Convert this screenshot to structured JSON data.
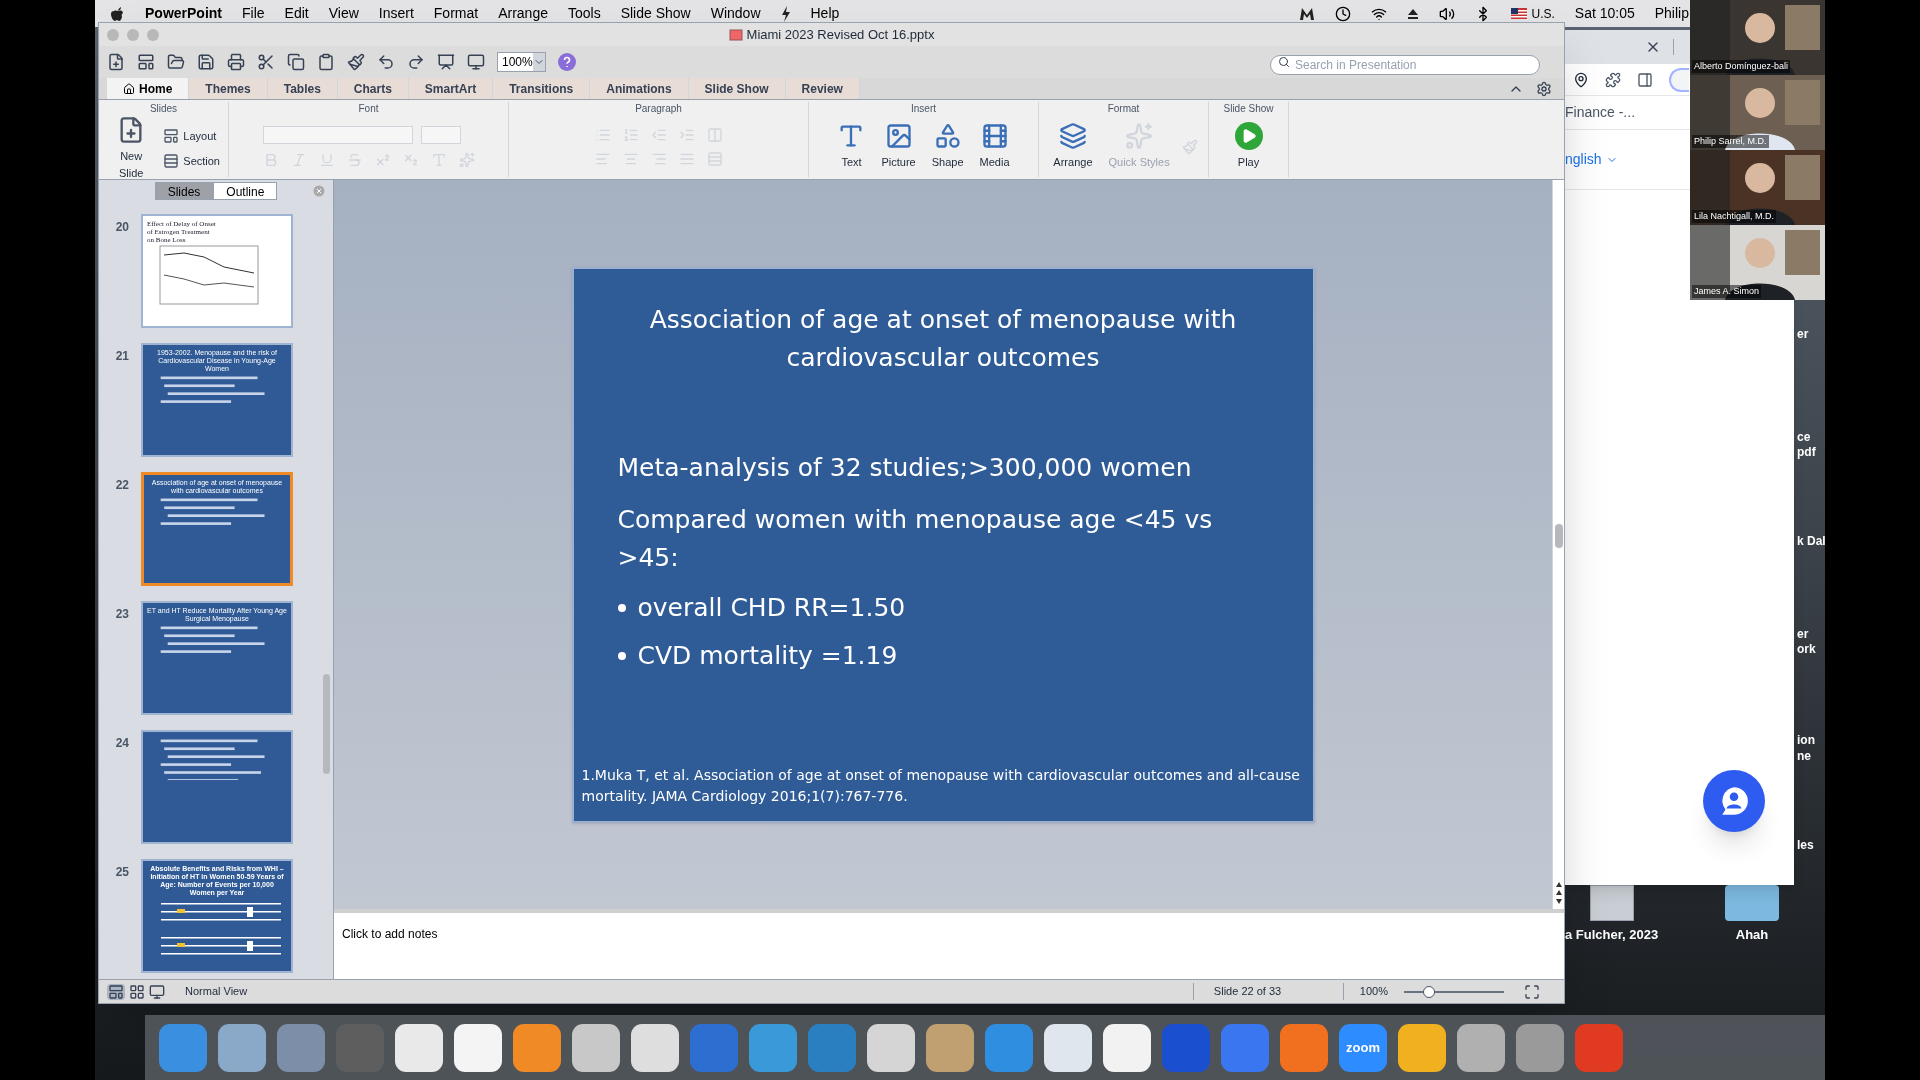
{
  "menu_bar": {
    "app": "PowerPoint",
    "items": [
      "File",
      "Edit",
      "View",
      "Insert",
      "Format",
      "Arrange",
      "Tools",
      "Slide Show",
      "Window",
      "Help"
    ],
    "input_source": "U.S.",
    "clock": "Sat 10:05",
    "user": "Philip"
  },
  "window": {
    "title": "Miami 2023 Revised Oct 16.pptx",
    "zoom": "100%",
    "search": {
      "placeholder": "Search in Presentation"
    }
  },
  "ribbon": {
    "tabs": [
      {
        "label": "Home",
        "selected": true
      },
      {
        "label": "Themes",
        "selected": false
      },
      {
        "label": "Tables",
        "selected": false
      },
      {
        "label": "Charts",
        "selected": false
      },
      {
        "label": "SmartArt",
        "selected": false
      },
      {
        "label": "Transitions",
        "selected": false
      },
      {
        "label": "Animations",
        "selected": false
      },
      {
        "label": "Slide Show",
        "selected": false
      },
      {
        "label": "Review",
        "selected": false
      }
    ],
    "groups": [
      "Slides",
      "Font",
      "Paragraph",
      "Insert",
      "Format",
      "Slide Show"
    ],
    "new_slide": "New Slide",
    "layout": "Layout",
    "section": "Section",
    "insert_buttons": [
      "Text",
      "Picture",
      "Shape",
      "Media"
    ],
    "format_buttons": [
      {
        "label": "Arrange",
        "disabled": false
      },
      {
        "label": "Quick Styles",
        "disabled": true
      }
    ],
    "play": "Play"
  },
  "pane": {
    "tabs": [
      {
        "label": "Slides",
        "selected": true
      },
      {
        "label": "Outline",
        "selected": false
      }
    ],
    "thumbnails": [
      {
        "number": "20",
        "kind": "chart",
        "title": "Effect of Delay of Onset of Estrogen Treatment on Bone Loss",
        "selected": false
      },
      {
        "number": "21",
        "kind": "text",
        "title": "1953-2002. Menopause and the risk of Cardiovascular Disease in Young-Age Women",
        "selected": false
      },
      {
        "number": "22",
        "kind": "text",
        "title": "Association of age at onset of menopause with cardiovascular outcomes",
        "selected": true
      },
      {
        "number": "23",
        "kind": "text",
        "title": "ET and HT Reduce Mortality After Young Age Surgical Menopause",
        "selected": false
      },
      {
        "number": "24",
        "kind": "text",
        "selected": false
      },
      {
        "number": "25",
        "kind": "table",
        "title": "Absolute Benefits and Risks from WHI – Initiation of HT in Women 50-59 Years of Age: Number of Events per 10,000 Women per Year",
        "selected": false
      }
    ]
  },
  "slide": {
    "title": "Association of age at onset of menopause with\ncardiovascular outcomes",
    "lines": [
      {
        "text": "Meta-analysis of 32 studies;>300,000 women",
        "bullet": false
      },
      {
        "text": "Compared women with menopause age <45 vs\n>45:",
        "bullet": false
      },
      {
        "text": "overall CHD RR=1.50",
        "bullet": true
      },
      {
        "text": "CVD mortality  =1.19",
        "bullet": true
      }
    ],
    "reference": "1.Muka T, et al. Association of age at onset of menopause with cardiovascular outcomes and all-cause mortality.  JAMA Cardiology 2016;1(7):767-776."
  },
  "notes": {
    "placeholder": "Click to add notes"
  },
  "status_bar": {
    "view": "Normal View",
    "slide": "Slide 22 of 33",
    "zoom": "100%",
    "level": 0.25
  },
  "browser": {
    "tab": "Finance -...",
    "language": "nglish"
  },
  "desktop": {
    "edge_labels": [
      "er",
      "ce",
      "pdf",
      "k Dal",
      "er",
      "ork",
      "ion",
      "ne",
      "les"
    ],
    "icons": [
      {
        "label": "a Fulcher, 2023",
        "kind": "document"
      },
      {
        "label": "Ahah",
        "kind": "folder"
      }
    ]
  },
  "video_tiles": [
    {
      "name": "Alberto Domínguez-bali"
    },
    {
      "name": "Philip Sarrel, M.D."
    },
    {
      "name": "Lila Nachtigall, M.D."
    },
    {
      "name": "James A. Simon"
    }
  ],
  "dock": [
    {
      "color": "#3b8fe0"
    },
    {
      "color": "#8aa8c8"
    },
    {
      "color": "#7d8fa8"
    },
    {
      "color": "#5e5e5e"
    },
    {
      "color": "#e9e9e9"
    },
    {
      "color": "#f4f4f4"
    },
    {
      "color": "#f08a24"
    },
    {
      "color": "#c8c8c8"
    },
    {
      "color": "#dedede"
    },
    {
      "color": "#2c6fd1"
    },
    {
      "color": "#3a9ad9"
    },
    {
      "color": "#2a7fc1"
    },
    {
      "color": "#d5d5d5"
    },
    {
      "color": "#c0a070"
    },
    {
      "color": "#2f8ee0"
    },
    {
      "color": "#dfe6ee"
    },
    {
      "color": "#f2f2f2"
    },
    {
      "color": "#1a4fd0"
    },
    {
      "color": "#3a76f0"
    },
    {
      "color": "#f07020"
    },
    {
      "color": "#2d8cff",
      "text": "zoom"
    },
    {
      "color": "#f0b020"
    },
    {
      "color": "#b0b0b0"
    },
    {
      "color": "#9a9a9a"
    },
    {
      "color": "#e03a20"
    }
  ]
}
